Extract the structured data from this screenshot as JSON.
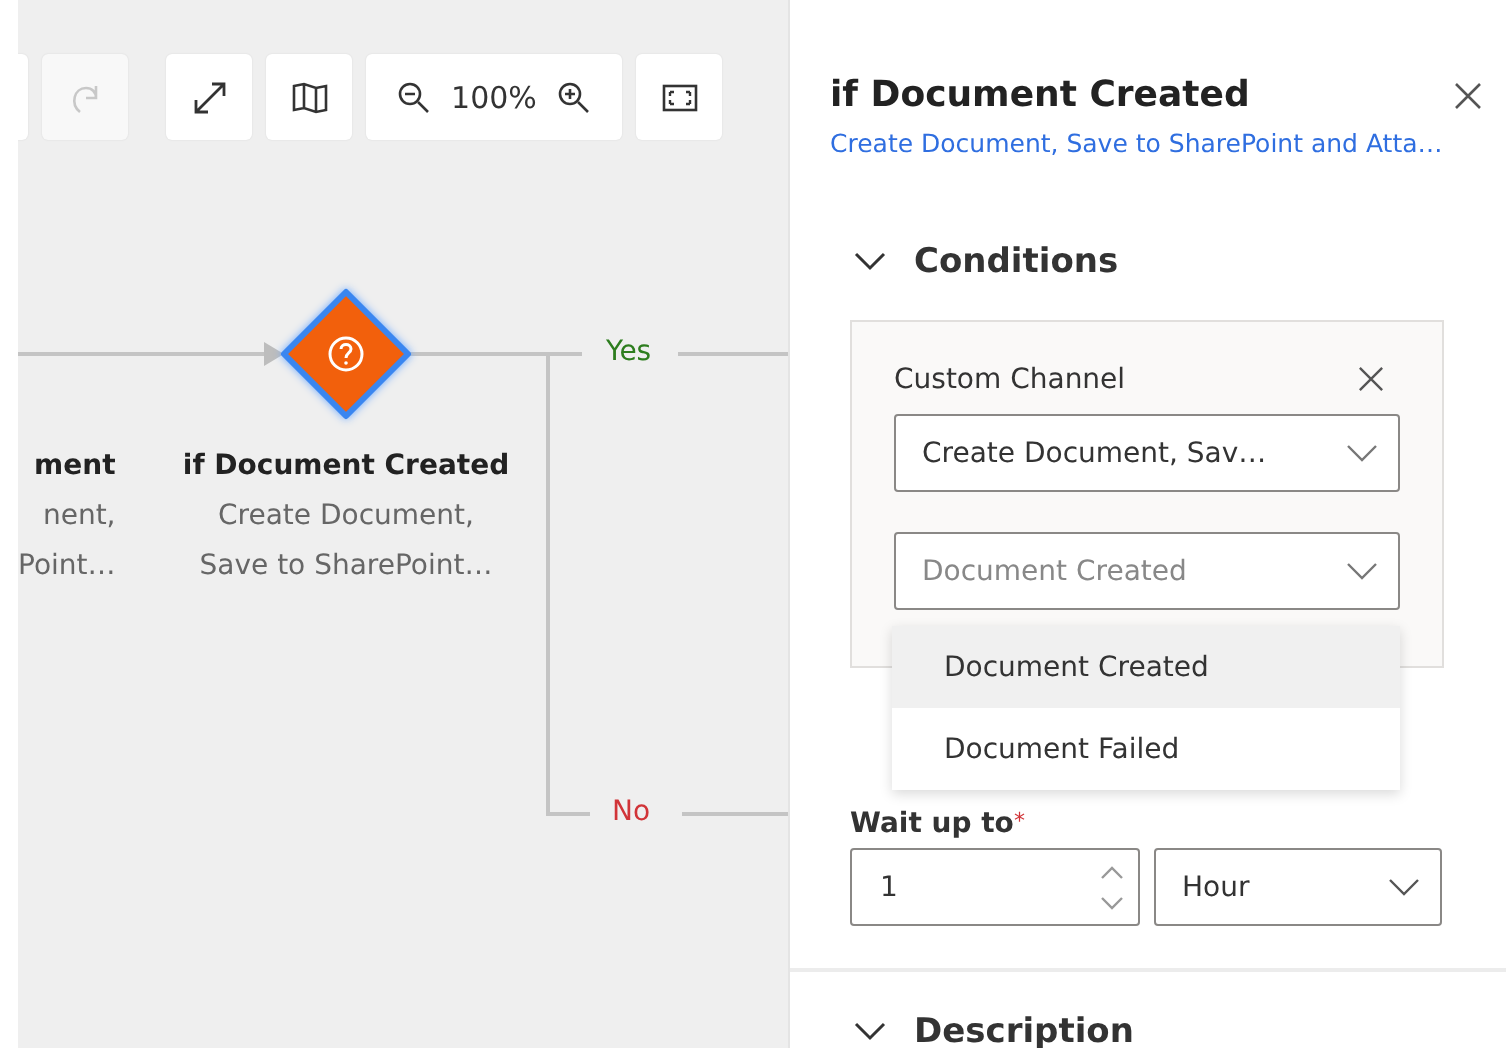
{
  "toolbar": {
    "buttons": [
      {
        "kind": "partial"
      },
      {
        "kind": "redo",
        "disabled": true
      },
      {
        "kind": "expand",
        "disabled": false
      },
      {
        "kind": "map",
        "disabled": false
      },
      {
        "kind": "zoom",
        "disabled": false,
        "label": "100%"
      },
      {
        "kind": "fit",
        "disabled": false
      }
    ]
  },
  "canvas": {
    "nodes": [
      {
        "kind": "cut",
        "title": "ment",
        "lines": [
          "nent,",
          "Point…"
        ]
      },
      {
        "kind": "condition",
        "selected": true,
        "title": "if Document Created",
        "lines": [
          "Create Document,",
          "Save to SharePoint…"
        ]
      }
    ],
    "branches": [
      {
        "kind": "yes",
        "label": "Yes"
      },
      {
        "kind": "no",
        "label": "No"
      }
    ]
  },
  "panel": {
    "title": "if Document Created",
    "subtitle": "Create Document, Save to SharePoint and Atta…",
    "conditions": {
      "title": "Conditions",
      "expanded": true,
      "label": "Custom Channel",
      "channel": "Create Document, Sav…",
      "event_placeholder": "Document Created",
      "options": [
        {
          "label": "Document Created",
          "selected": true
        },
        {
          "label": "Document Failed",
          "selected": false
        }
      ]
    },
    "wait": {
      "label": "Wait up to",
      "required_mark": "*",
      "value": "1",
      "unit": "Hour"
    },
    "description": {
      "title": "Description",
      "expanded": true
    }
  }
}
